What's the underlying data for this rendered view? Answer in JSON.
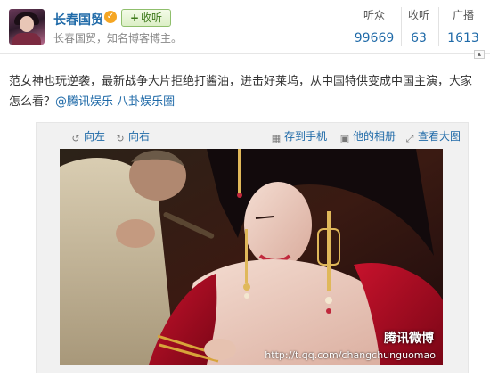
{
  "author": {
    "name": "长春国贸",
    "follow_label": "收听",
    "bio": "长春国贸，知名博客博主。"
  },
  "stats": [
    {
      "label": "听众",
      "value": "99669"
    },
    {
      "label": "收听",
      "value": "63"
    },
    {
      "label": "广播",
      "value": "1613"
    }
  ],
  "post": {
    "text": "范女神也玩逆袭，最新战争大片拒绝打酱油，进击好莱坞，从中国特供变成中国主演，大家怎么看？",
    "mentions": "@腾讯娱乐 八卦娱乐圈"
  },
  "image_toolbar": {
    "rotate_left": "向左",
    "rotate_right": "向右",
    "save_to_phone": "存到手机",
    "album": "他的相册",
    "view_large": "查看大图"
  },
  "photo": {
    "watermark_logo": "腾讯微博",
    "watermark_url": "http://t.qq.com/changchunguomao"
  },
  "colors": {
    "link": "#1f6aa8",
    "follow_green": "#3f7a1c",
    "verified": "#f5a623"
  }
}
